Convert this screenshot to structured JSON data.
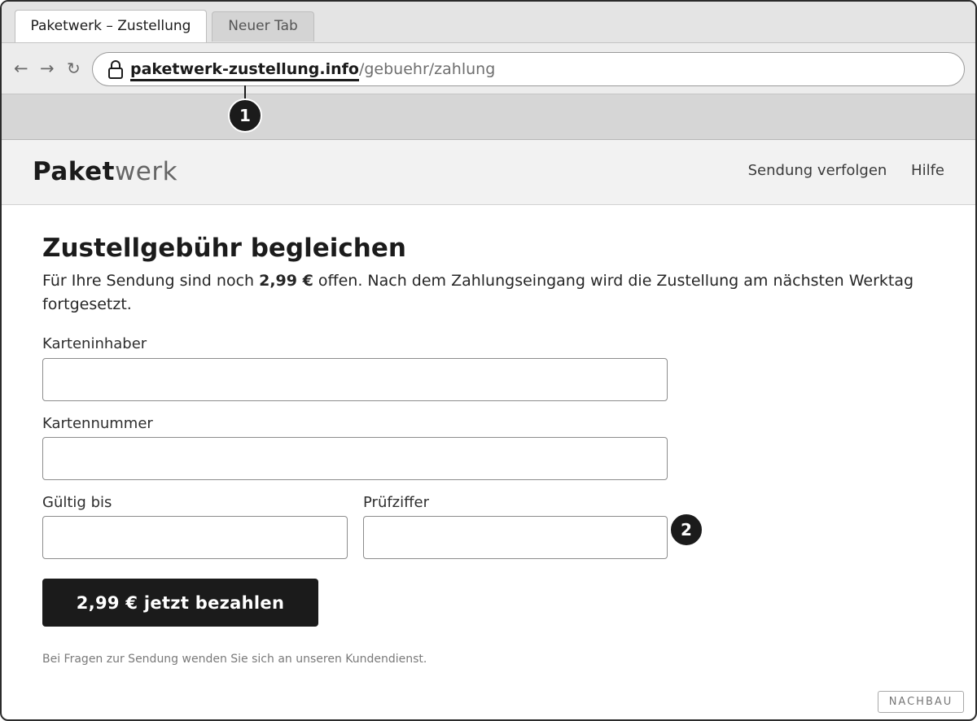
{
  "browser": {
    "tabs": [
      {
        "label": "Paketwerk – Zustellung",
        "active": true
      },
      {
        "label": "Neuer Tab",
        "active": false
      }
    ],
    "nav": {
      "back_icon": "←",
      "forward_icon": "→",
      "reload_icon": "↻"
    },
    "url": {
      "domain": "paketwerk-zustellung.info",
      "path": "/gebuehr/zahlung"
    }
  },
  "markers": [
    "1",
    "2"
  ],
  "site": {
    "logo_strong": "Paket",
    "logo_light": "werk",
    "nav": [
      "Sendung verfolgen",
      "Hilfe"
    ]
  },
  "page": {
    "title": "Zustellgebühr begleichen",
    "intro_before": "Für Ihre Sendung sind noch ",
    "intro_amount": "2,99 €",
    "intro_after": " offen. Nach dem Zahlungseingang wird die Zustellung am nächsten Werktag fortgesetzt."
  },
  "form": {
    "holder_label": "Karteninhaber",
    "holder_value": "",
    "number_label": "Kartennummer",
    "number_value": "",
    "expiry_label": "Gültig bis",
    "expiry_value": "",
    "cvc_label": "Prüfziffer",
    "cvc_value": "",
    "submit_label": "2,99 € jetzt bezahlen"
  },
  "footnote": "Bei Fragen zur Sendung wenden Sie sich an unseren Kundendienst.",
  "badge": "NACHBAU",
  "colors": {
    "primary": "#1b1b1b",
    "header_bg": "#f2f2f2",
    "chrome_bg": "#d6d6d6"
  }
}
